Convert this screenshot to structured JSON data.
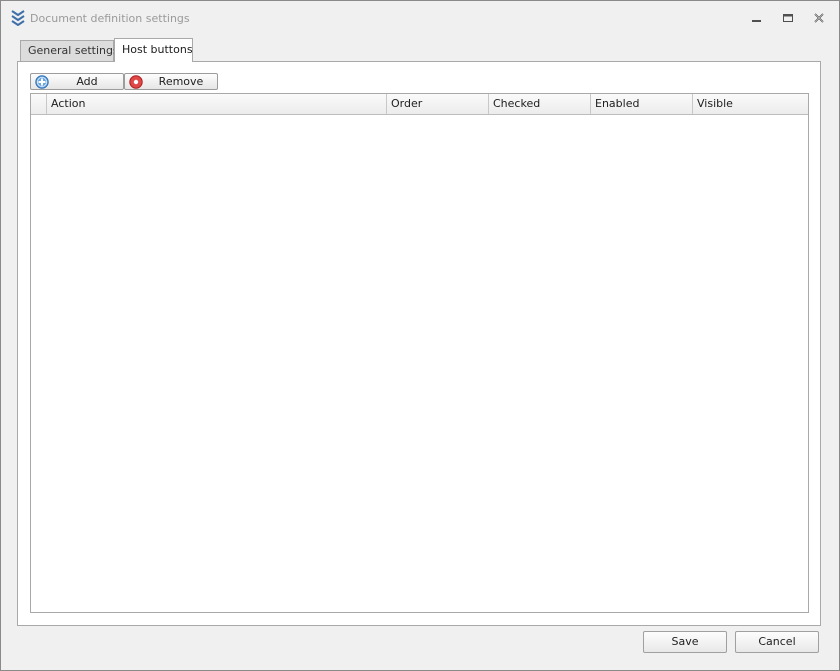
{
  "window": {
    "title": "Document definition settings",
    "icon": "chevrons-down-app-icon",
    "controls": [
      "minimize-icon",
      "restore-icon",
      "close-icon"
    ]
  },
  "tabs": [
    {
      "label": "General settings",
      "selected": false
    },
    {
      "label": "Host buttons",
      "selected": true
    }
  ],
  "toolbar": {
    "add_label": "Add",
    "add_icon": "add-circle-icon",
    "remove_label": "Remove",
    "remove_icon": "remove-circle-icon"
  },
  "grid": {
    "columns": [
      "Action",
      "Order",
      "Checked",
      "Enabled",
      "Visible"
    ],
    "rows": []
  },
  "footer": {
    "save_label": "Save",
    "cancel_label": "Cancel"
  },
  "colors": {
    "title_text": "#9a9a9a",
    "app_icon": "#3e6fa8",
    "add_icon": "#4a8fd0",
    "remove_icon": "#d03030"
  }
}
